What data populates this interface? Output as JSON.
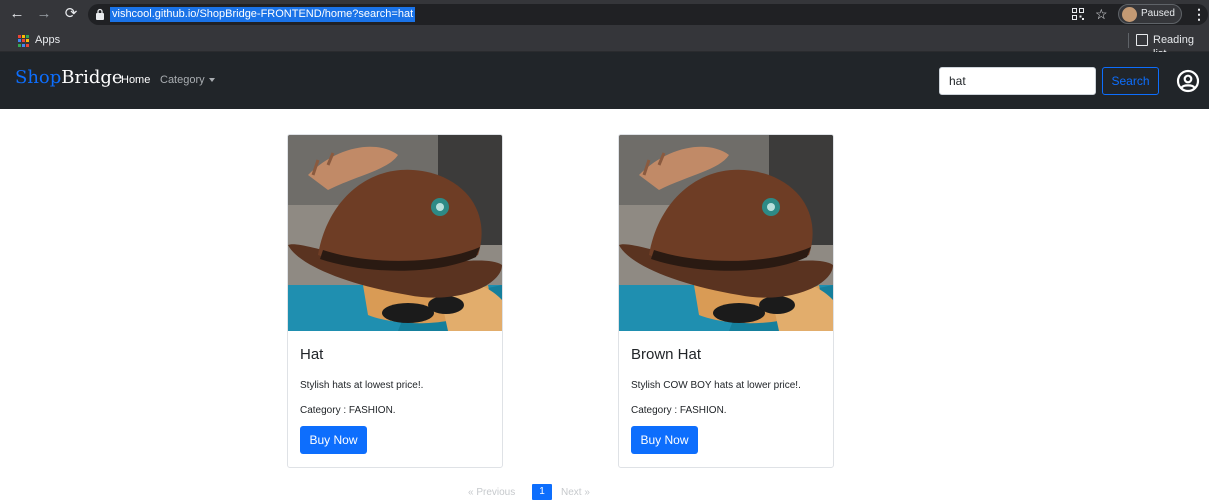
{
  "browser": {
    "url": "vishcool.github.io/ShopBridge-FRONTEND/home?search=hat",
    "profile_label": "Paused",
    "bookmarks": {
      "apps_label": "Apps",
      "reading_list_label": "Reading list"
    }
  },
  "navbar": {
    "brand_part1": "Shop",
    "brand_part2": "Bridge",
    "links": [
      {
        "label": "Home"
      },
      {
        "label": "Category"
      }
    ],
    "search": {
      "value": "hat",
      "button_label": "Search"
    }
  },
  "products": [
    {
      "title": "Hat",
      "description": "Stylish hats at lowest price!.",
      "category": "Category : FASHION.",
      "buy_label": "Buy Now"
    },
    {
      "title": "Brown Hat",
      "description": "Stylish COW BOY hats at lower price!.",
      "category": "Category : FASHION.",
      "buy_label": "Buy Now"
    }
  ],
  "pagination": {
    "previous_label": "« Previous",
    "current_page": "1",
    "next_label": "Next »"
  },
  "colors": {
    "navbar_bg": "#212529",
    "primary": "#0d6efd",
    "browser_chrome": "#35363a"
  },
  "icons": [
    "back-arrow-icon",
    "forward-arrow-icon",
    "reload-icon",
    "lock-icon",
    "qr-code-icon",
    "star-icon",
    "menu-dots-icon",
    "apps-grid-icon",
    "reading-list-icon",
    "user-circle-icon",
    "caret-down-icon"
  ]
}
